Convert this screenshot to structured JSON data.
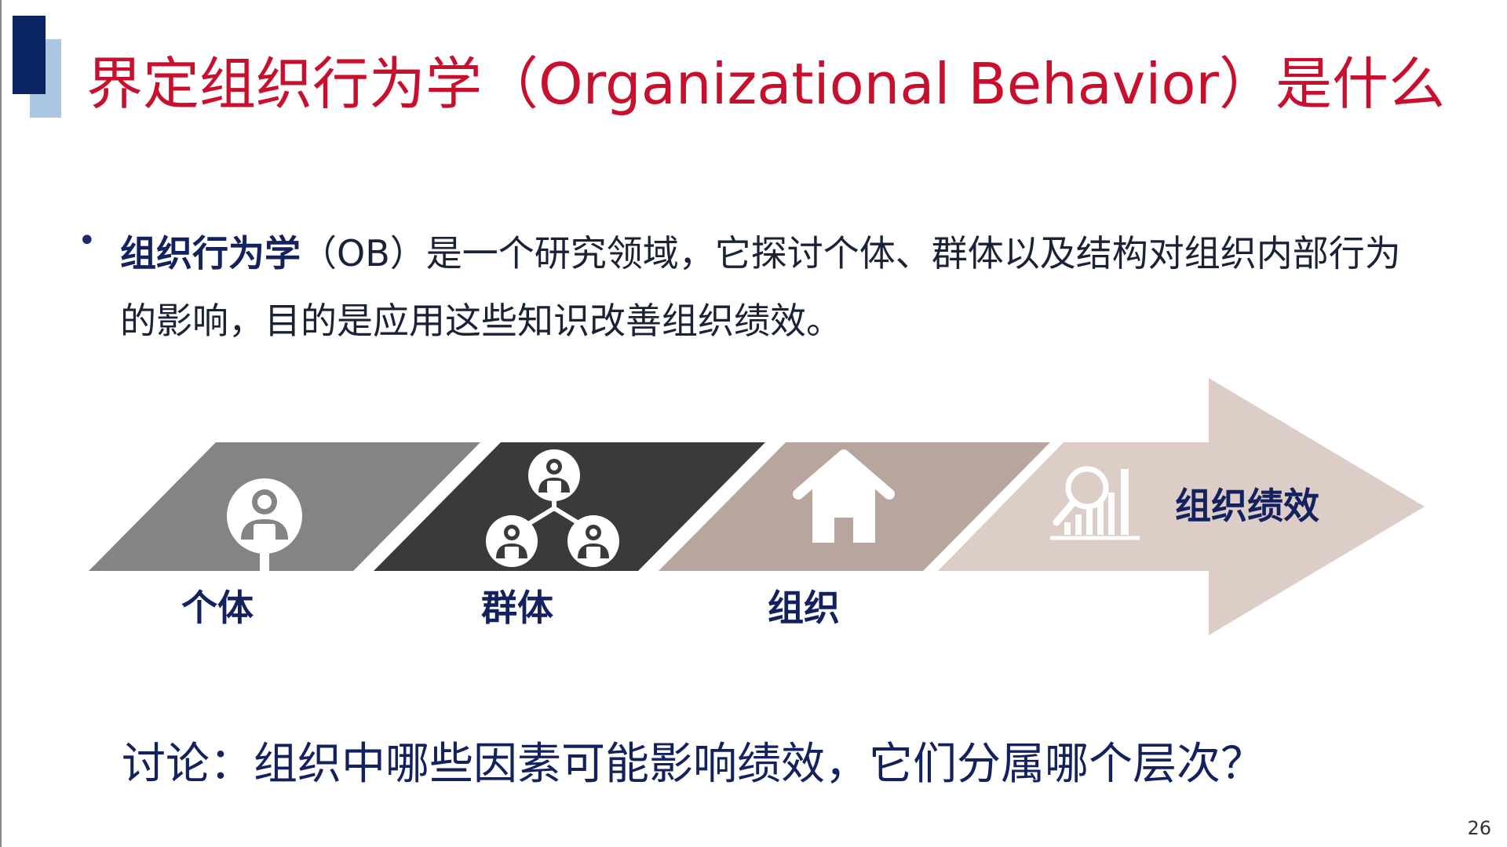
{
  "title": "界定组织行为学（Organizational Behavior）是什么",
  "definition": {
    "term": "组织行为学",
    "rest": "（OB）是一个研究领域，它探讨个体、群体以及结构对组织内部行为的影响，目的是应用这些知识改善组织绩效。"
  },
  "levels": [
    {
      "label": "个体",
      "icon": "person-icon",
      "color": "#848484"
    },
    {
      "label": "群体",
      "icon": "group-icon",
      "color": "#3a3a3a"
    },
    {
      "label": "组织",
      "icon": "house-icon",
      "color": "#b8a59d"
    }
  ],
  "goal": {
    "label": "组织绩效",
    "icon": "chart-magnifier-icon",
    "color": "#dccdc6"
  },
  "question": "讨论：组织中哪些因素可能影响绩效，它们分属哪个层次？",
  "page_number": "26",
  "colors": {
    "title_red": "#c8102e",
    "navy_text": "#14215f",
    "deco_dark": "#0a2463",
    "deco_light": "#a9c6e3"
  }
}
